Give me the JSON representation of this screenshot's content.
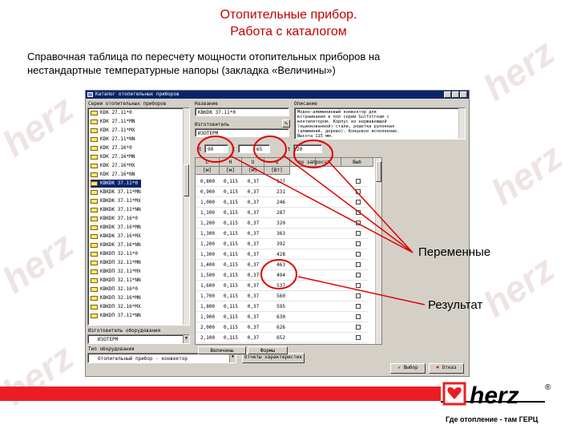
{
  "slide": {
    "title_line1": "Отопительные прибор.",
    "title_line2": "Работа с каталогом",
    "subtitle_line1": "Справочная таблица по пересчету мощности отопительных приборов на",
    "subtitle_line2": "нестандартные температурные напоры (закладка «Величины»)",
    "annotation_variables": "Переменные",
    "annotation_result": "Результат",
    "watermark": "herz",
    "logo_text": "herz",
    "registered": "®",
    "slogan": "Где отопление - там ГЕРЦ",
    "accent_color": "#ed1c24"
  },
  "window": {
    "title": "Каталог отопительных приборов",
    "series_label": "Серии отопительных приборов",
    "series": [
      "KDK 27.11*0",
      "KDK 27.11*MN",
      "KDK 27.11*MX",
      "KDK 27.11*NN",
      "KDK 27.16*0",
      "KDK 27.16*MN",
      "KDK 27.16*MX",
      "KDK 27.16*NN",
      "KBKDK 37.11*0",
      "KBKDK 37.11*MN",
      "KBKDK 37.11*MX",
      "KBKDK 37.11*NN",
      "KBKDK 37.16*0",
      "KBKDK 37.16*MN",
      "KBKDK 37.16*MX",
      "KBKDK 37.16*NN",
      "KBKDП 32.11*0",
      "KBKDП 32.11*MN",
      "KBKDП 32.11*MX",
      "KBKDП 32.11*NN",
      "KBKDП 32.16*0",
      "KBKDП 32.16*MN",
      "KBKDП 32.16*MX",
      "KBKDП 37.11*NN"
    ],
    "selected_series_index": 8,
    "manufacturer_label": "Изготовитель оборудования",
    "manufacturer_value": "ИЗОТЕРМ",
    "equipment_type_label": "Тип оборудования",
    "equipment_type_value": "Отопительный прибор - конвектор",
    "print_button": "Отчеты характеристик",
    "name_label": "Название",
    "name_value": "KBKDK 37.11*0",
    "manufacturer_field_label": "Изготовитель",
    "manufacturer_field_value": "ИЗОТЕРМ",
    "description_label": "Описание",
    "description_lines": [
      "Медно-алюминиевый конвектор для",
      "встраивания в пол серии Gulfstream с",
      "вентилятором. Корпус из нержавеющей",
      "(оцинкованной) стали, решетка рулонная",
      "(алюминий, дерево). Концевое исполнение.",
      "Высота 115 мм."
    ],
    "param_t1_label": "t",
    "param_t1_value": "90",
    "param_t2_label": "t",
    "param_t2_value": "65",
    "param_t3_label": "t",
    "param_t3_value": "20",
    "sort_label": "по запросу",
    "table_headers_top": [
      "L",
      "H",
      "U",
      "Q",
      "",
      "",
      "Выб"
    ],
    "table_headers_units": [
      "[м]",
      "[м]",
      "[м]",
      "[Вт]"
    ],
    "table_rows": [
      [
        "0,800",
        "0,115",
        "0,37",
        "127"
      ],
      [
        "0,900",
        "0,115",
        "0,37",
        "231"
      ],
      [
        "1,000",
        "0,115",
        "0,37",
        "246"
      ],
      [
        "1,100",
        "0,115",
        "0,37",
        "287"
      ],
      [
        "1,200",
        "0,115",
        "0,37",
        "320"
      ],
      [
        "1,300",
        "0,115",
        "0,37",
        "363"
      ],
      [
        "1,200",
        "0,115",
        "0,37",
        "392"
      ],
      [
        "1,300",
        "0,115",
        "0,37",
        "428"
      ],
      [
        "1,400",
        "0,115",
        "0,37",
        "463"
      ],
      [
        "1,500",
        "0,115",
        "0,37",
        "494"
      ],
      [
        "1,600",
        "0,115",
        "0,37",
        "537"
      ],
      [
        "1,700",
        "0,115",
        "0,37",
        "560"
      ],
      [
        "1,800",
        "0,115",
        "0,37",
        "595"
      ],
      [
        "1,900",
        "0,115",
        "0,37",
        "630"
      ],
      [
        "2,000",
        "0,115",
        "0,37",
        "626"
      ],
      [
        "2,100",
        "0,115",
        "0,37",
        "652"
      ]
    ],
    "tab_values": "Величины",
    "tab_other": "Формы",
    "ok_button": "Выбор",
    "cancel_button": "Отказ"
  }
}
